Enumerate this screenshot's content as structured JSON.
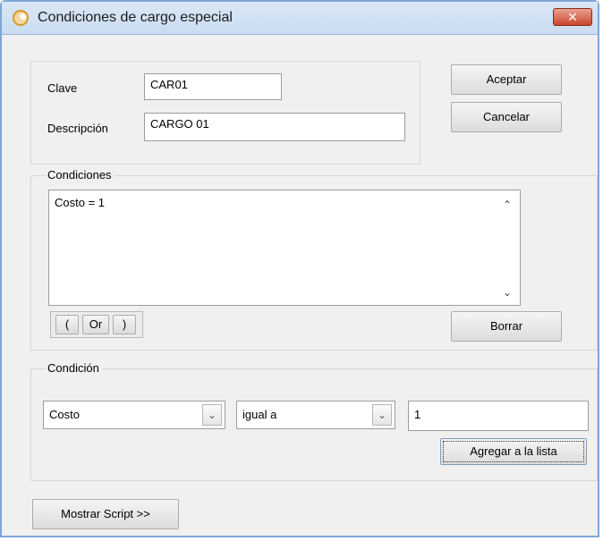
{
  "window": {
    "title": "Condiciones de cargo especial",
    "close_label": "✕"
  },
  "header": {
    "clave_label": "Clave",
    "clave_value": "CAR01",
    "descripcion_label": "Descripción",
    "descripcion_value": "CARGO 01"
  },
  "actions": {
    "aceptar": "Aceptar",
    "cancelar": "Cancelar"
  },
  "condiciones": {
    "legend": "Condiciones",
    "items": [
      "Costo = 1"
    ],
    "open_paren": "(",
    "or": "Or",
    "close_paren": ")",
    "borrar": "Borrar"
  },
  "condicion": {
    "legend": "Condición",
    "field": "Costo",
    "operator": "igual a",
    "value": "1",
    "add_button": "Agregar a la lista"
  },
  "footer": {
    "mostrar_script": "Mostrar Script >>"
  }
}
